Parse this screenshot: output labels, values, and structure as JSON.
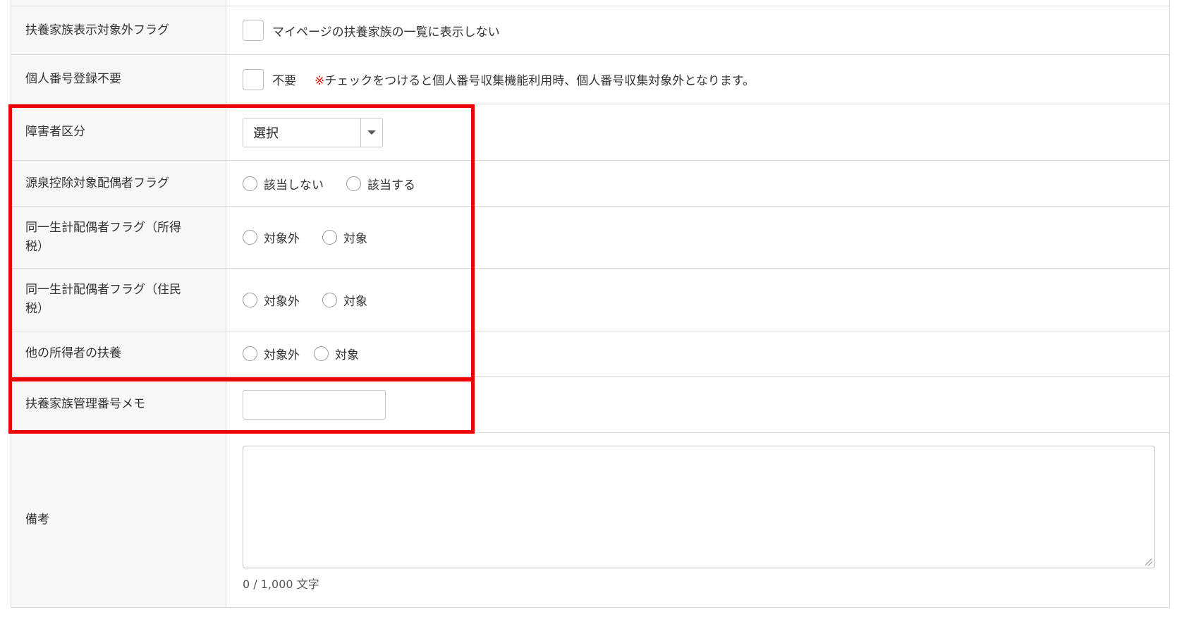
{
  "rows": {
    "hide_flag": {
      "label": "扶養家族表示対象外フラグ",
      "checkbox_text": "マイページの扶養家族の一覧に表示しない"
    },
    "my_number_unneeded": {
      "label": "個人番号登録不要",
      "checkbox_text": "不要",
      "note_mark": "※",
      "note_text": "チェックをつけると個人番号収集機能利用時、個人番号収集対象外となります。"
    },
    "disability": {
      "label": "障害者区分",
      "select_value": "選択"
    },
    "withholding_spouse": {
      "label": "源泉控除対象配偶者フラグ",
      "options": [
        "該当しない",
        "該当する"
      ]
    },
    "same_household_income": {
      "label": "同一生計配偶者フラグ（所得税）",
      "options": [
        "対象外",
        "対象"
      ]
    },
    "same_household_resident": {
      "label": "同一生計配偶者フラグ（住民税）",
      "options": [
        "対象外",
        "対象"
      ]
    },
    "other_dependent": {
      "label": "他の所得者の扶養",
      "options": [
        "対象外",
        "対象"
      ]
    },
    "memo": {
      "label": "扶養家族管理番号メモ",
      "value": ""
    },
    "remarks": {
      "label": "備考",
      "value": "",
      "counter": "0 / 1,000 文字"
    }
  },
  "colors": {
    "highlight": "#ee0000",
    "label_bg": "#f7f7f7",
    "border": "#dcdcdc"
  }
}
